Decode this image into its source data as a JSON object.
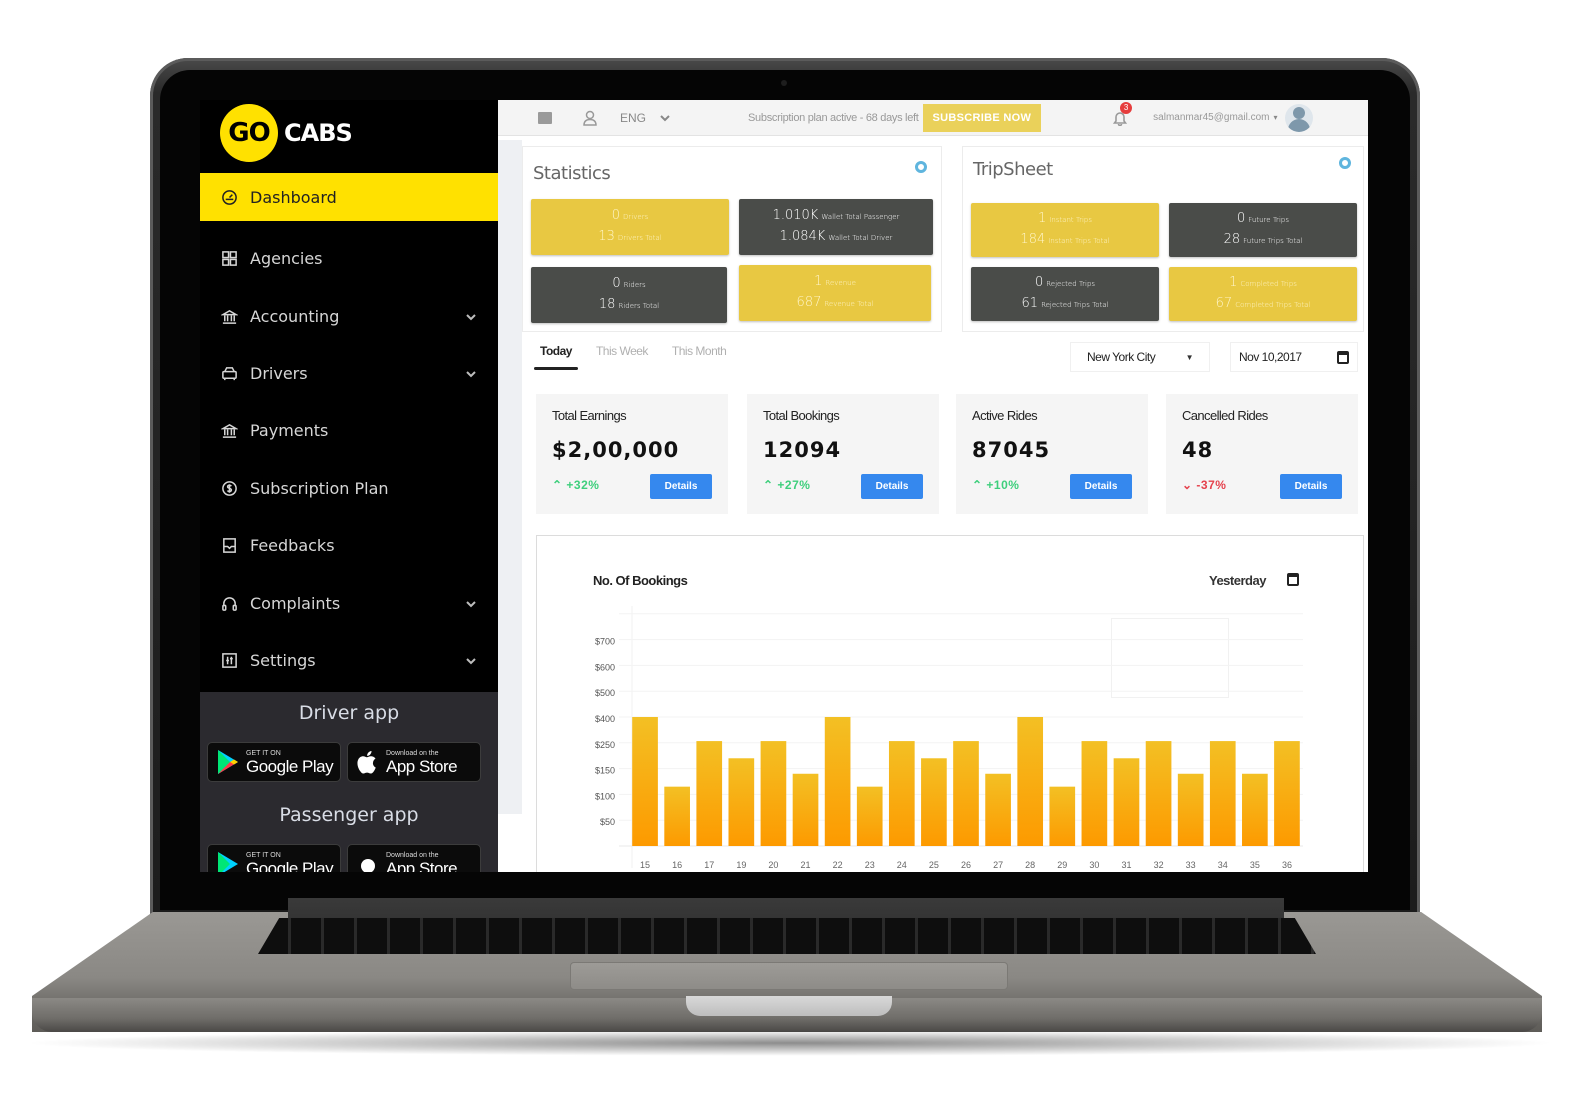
{
  "brand": {
    "logo_circle": "GO",
    "logo_text": "CABS",
    "accent": "#ffe100"
  },
  "sidebar": {
    "items": [
      {
        "label": "Dashboard",
        "icon": "speedometer-icon",
        "active": true,
        "has_children": false
      },
      {
        "label": "Agencies",
        "icon": "grid-icon",
        "active": false,
        "has_children": false
      },
      {
        "label": "Accounting",
        "icon": "bank-icon",
        "active": false,
        "has_children": true
      },
      {
        "label": "Drivers",
        "icon": "car-icon",
        "active": false,
        "has_children": true
      },
      {
        "label": "Payments",
        "icon": "bank-icon",
        "active": false,
        "has_children": false
      },
      {
        "label": "Subscription Plan",
        "icon": "dollar-circle-icon",
        "active": false,
        "has_children": false
      },
      {
        "label": "Feedbacks",
        "icon": "inbox-icon",
        "active": false,
        "has_children": false
      },
      {
        "label": "Complaints",
        "icon": "headphones-icon",
        "active": false,
        "has_children": true
      },
      {
        "label": "Settings",
        "icon": "sliders-icon",
        "active": false,
        "has_children": true
      }
    ],
    "apps": {
      "driver_title": "Driver app",
      "passenger_title": "Passenger app",
      "google_small": "GET IT ON",
      "google_big": "Google Play",
      "apple_small": "Download on the",
      "apple_big": "App Store"
    }
  },
  "topbar": {
    "language": "ENG",
    "subscription_text": "Subscription plan active - 68 days left",
    "subscribe_button": "SUBSCRIBE NOW",
    "notification_count": "3",
    "user_email": "salmanmar45@gmail.com",
    "email_caret": "▾"
  },
  "statistics": {
    "title": "Statistics",
    "tiles": [
      {
        "color": "yellow",
        "lines": [
          {
            "value": "0",
            "label": "Drivers"
          },
          {
            "value": "13",
            "label": "Drivers Total"
          }
        ]
      },
      {
        "color": "dark",
        "lines": [
          {
            "value": "1.010K",
            "label": "Wallet Total Passenger"
          },
          {
            "value": "1.084K",
            "label": "Wallet Total Driver"
          }
        ]
      },
      {
        "color": "dark",
        "lines": [
          {
            "value": "0",
            "label": "Riders"
          },
          {
            "value": "18",
            "label": "Riders Total"
          }
        ]
      },
      {
        "color": "yellow",
        "lines": [
          {
            "value": "1",
            "label": "Revenue"
          },
          {
            "value": "687",
            "label": "Revenue Total"
          }
        ]
      }
    ]
  },
  "tripsheet": {
    "title": "TripSheet",
    "tiles": [
      {
        "color": "yellow",
        "lines": [
          {
            "value": "1",
            "label": "Instant Trips"
          },
          {
            "value": "184",
            "label": "Instant Trips Total"
          }
        ]
      },
      {
        "color": "dark",
        "lines": [
          {
            "value": "0",
            "label": "Future Trips"
          },
          {
            "value": "28",
            "label": "Future Trips Total"
          }
        ]
      },
      {
        "color": "dark",
        "lines": [
          {
            "value": "0",
            "label": "Rejected Trips"
          },
          {
            "value": "61",
            "label": "Rejected Trips Total"
          }
        ]
      },
      {
        "color": "yellow",
        "lines": [
          {
            "value": "1",
            "label": "Completed Trips"
          },
          {
            "value": "67",
            "label": "Completed Trips Total"
          }
        ]
      }
    ]
  },
  "filters": {
    "tabs": [
      {
        "label": "Today",
        "active": true
      },
      {
        "label": "This Week",
        "active": false
      },
      {
        "label": "This Month",
        "active": false
      }
    ],
    "city": "New York City",
    "date": "Nov 10,2017"
  },
  "kpis": [
    {
      "title": "Total Earnings",
      "value": "$2,00,000",
      "delta": "+32%",
      "trend": "up",
      "button": "Details"
    },
    {
      "title": "Total Bookings",
      "value": "12094",
      "delta": "+27%",
      "trend": "up",
      "button": "Details"
    },
    {
      "title": "Active Rides",
      "value": "87045",
      "delta": "+10%",
      "trend": "up",
      "button": "Details"
    },
    {
      "title": "Cancelled Rides",
      "value": "48",
      "delta": "-37%",
      "trend": "down",
      "button": "Details"
    }
  ],
  "colors": {
    "up": "#3ecf7c",
    "down": "#e5424d",
    "button": "#3588ee",
    "bar_top": "#f3c024",
    "bar_bottom": "#fd9a00"
  },
  "chart_data": {
    "type": "bar",
    "title": "No. Of Bookings",
    "range_label": "Yesterday",
    "xlabel": "",
    "ylabel": "",
    "y_ticks": [
      "$50",
      "$100",
      "$150",
      "$250",
      "$400",
      "$500",
      "$600",
      "$700"
    ],
    "y_tick_values": [
      50,
      100,
      150,
      250,
      400,
      500,
      600,
      700
    ],
    "grid": true,
    "categories": [
      "15",
      "16",
      "17",
      "19",
      "20",
      "21",
      "22",
      "23",
      "24",
      "25",
      "26",
      "27",
      "28",
      "29",
      "30",
      "31",
      "32",
      "33",
      "34",
      "35",
      "36"
    ],
    "values": [
      400,
      115,
      260,
      190,
      260,
      140,
      400,
      115,
      260,
      190,
      260,
      140,
      400,
      115,
      260,
      190,
      260,
      140,
      260,
      140,
      260
    ]
  }
}
